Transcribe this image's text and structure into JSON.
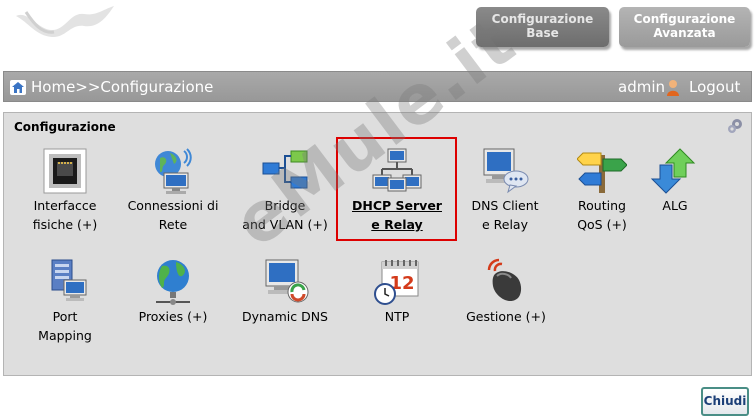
{
  "top_buttons": {
    "base": {
      "line1": "Configurazione",
      "line2": "Base"
    },
    "advanced": {
      "line1": "Configurazione",
      "line2": "Avanzata"
    }
  },
  "header": {
    "breadcrumb": "Home>>Configurazione",
    "user": "admin",
    "logout": "Logout"
  },
  "panel": {
    "title": "Configurazione",
    "items": [
      {
        "line1": "Interfacce",
        "line2": "fisiche (+)",
        "icon": "ethernet-port-icon"
      },
      {
        "line1": "Connessioni di",
        "line2": "Rete",
        "icon": "network-globe-icon"
      },
      {
        "line1": "Bridge",
        "line2": "and VLAN (+)",
        "icon": "bridge-vlan-icon"
      },
      {
        "line1": "DHCP Server",
        "line2": "e Relay",
        "icon": "dhcp-network-icon",
        "selected": true
      },
      {
        "line1": "DNS Client",
        "line2": "e Relay",
        "icon": "dns-client-icon"
      },
      {
        "line1": "Routing",
        "line2": "QoS (+)",
        "icon": "routing-signpost-icon"
      },
      {
        "line1": "ALG",
        "line2": "",
        "icon": "alg-arrows-icon"
      },
      {
        "line1": "Port",
        "line2": "Mapping",
        "icon": "port-mapping-icon"
      },
      {
        "line1": "Proxies (+)",
        "line2": "",
        "icon": "proxy-globe-icon"
      },
      {
        "line1": "Dynamic DNS",
        "line2": "",
        "icon": "dynamic-dns-icon"
      },
      {
        "line1": "NTP",
        "line2": "",
        "icon": "ntp-calendar-clock-icon",
        "calendar_day": "12"
      },
      {
        "line1": "Gestione (+)",
        "line2": "",
        "icon": "management-mouse-icon"
      }
    ]
  },
  "watermark": "eMule.it",
  "close_button": "Chiudi",
  "colors": {
    "selection_border": "#dd0000",
    "header_bar": "#a0a0a0",
    "panel_bg": "#dedede"
  }
}
